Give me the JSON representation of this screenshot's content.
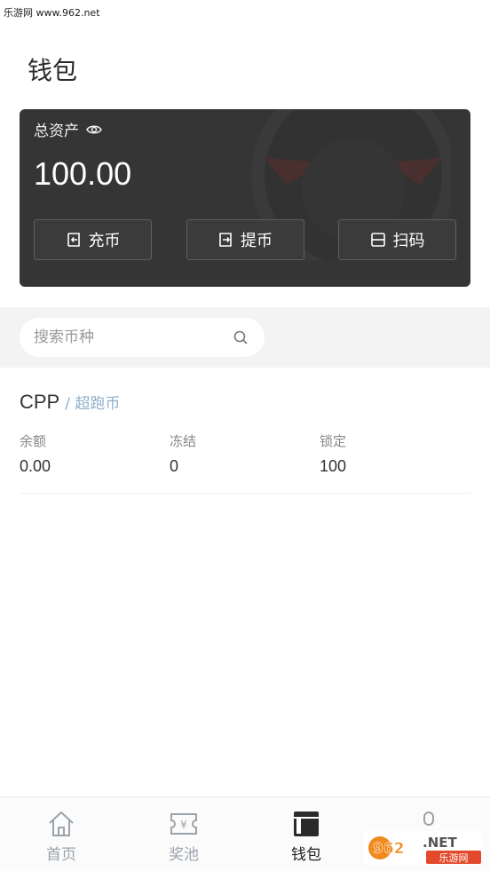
{
  "watermark_top": "乐游网 www.962.net",
  "page_title": "钱包",
  "card": {
    "total_label": "总资产",
    "total_value": "100.00",
    "actions": [
      {
        "label": "充币",
        "icon": "deposit-icon"
      },
      {
        "label": "提币",
        "icon": "withdraw-icon"
      },
      {
        "label": "扫码",
        "icon": "scan-icon"
      }
    ]
  },
  "search": {
    "placeholder": "搜索币种",
    "icon": "search-icon"
  },
  "coin": {
    "symbol": "CPP",
    "name": "/ 超跑币",
    "stats": [
      {
        "label": "余额",
        "value": "0.00"
      },
      {
        "label": "冻结",
        "value": "0"
      },
      {
        "label": "锁定",
        "value": "100"
      }
    ]
  },
  "tabbar": {
    "items": [
      {
        "label": "首页",
        "icon": "home-icon",
        "active": false
      },
      {
        "label": "奖池",
        "icon": "ticket-icon",
        "active": false
      },
      {
        "label": "钱包",
        "icon": "wallet-icon",
        "active": true
      },
      {
        "label": "",
        "icon": "profile-icon",
        "active": false
      }
    ]
  },
  "logo_badge": {
    "brand": "962.NET",
    "sub": "乐游网"
  },
  "colors": {
    "card_bg": "#353535",
    "accent_name": "#8fb0cc",
    "tab_inactive": "#9aa3ab"
  }
}
